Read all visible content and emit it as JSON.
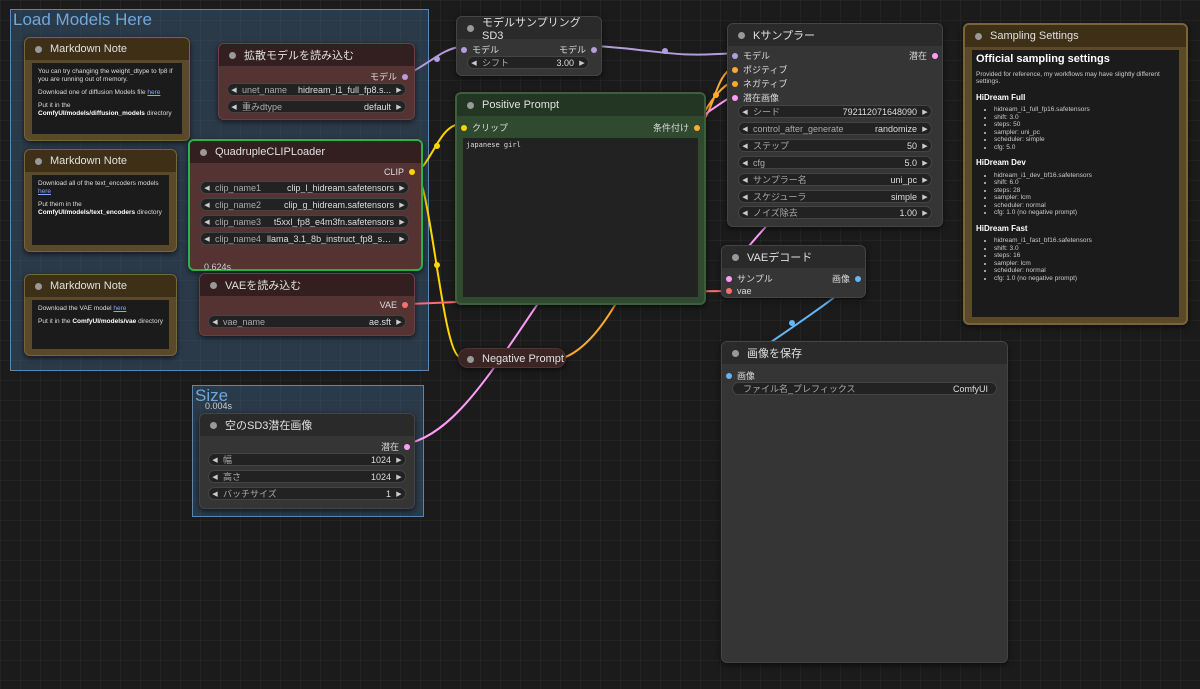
{
  "groups": {
    "load_models": {
      "title": "Load Models Here"
    },
    "size": {
      "title": "Size",
      "time": "0.004s"
    }
  },
  "notes": [
    {
      "title": "Markdown Note",
      "lines": [
        {
          "text": "You can try changing the weight_dtype to fp8 if you are running out of memory."
        },
        {
          "text": "Download one of diffusion Models file ",
          "link": "here"
        },
        {
          "text": "Put it in the ",
          "bold": "ComfyUI/models/diffusion_models",
          "after": " directory"
        }
      ]
    },
    {
      "title": "Markdown Note",
      "lines": [
        {
          "text": "Download all of the text_encoders models ",
          "link": "here"
        },
        {
          "text": "Put them in the ",
          "bold": "ComfyUI/models/text_encoders",
          "after": " directory"
        }
      ]
    },
    {
      "title": "Markdown Note",
      "lines": [
        {
          "text": "Download the VAE model ",
          "link": "here"
        },
        {
          "text": "Put it in the ",
          "bold": "ComfyUI/models/vae",
          "after": " directory"
        }
      ]
    }
  ],
  "unet_loader": {
    "title": "拡散モデルを読み込む",
    "output": "モデル",
    "widgets": [
      {
        "label": "unet_name",
        "value": "hidream_i1_full_fp8.s..."
      },
      {
        "label": "重みdtype",
        "value": "default"
      }
    ]
  },
  "clip_loader": {
    "title": "QuadrupleCLIPLoader",
    "output": "CLIP",
    "time": "0.624s",
    "widgets": [
      {
        "label": "clip_name1",
        "value": "clip_l_hidream.safetensors"
      },
      {
        "label": "clip_name2",
        "value": "clip_g_hidream.safetensors"
      },
      {
        "label": "clip_name3",
        "value": "t5xxl_fp8_e4m3fn.safetensors"
      },
      {
        "label": "clip_name4",
        "value": "llama_3.1_8b_instruct_fp8_sc..."
      }
    ]
  },
  "vae_loader": {
    "title": "VAEを読み込む",
    "output": "VAE",
    "widgets": [
      {
        "label": "vae_name",
        "value": "ae.sft"
      }
    ]
  },
  "model_sampling": {
    "title": "モデルサンプリングSD3",
    "input": "モデル",
    "output": "モデル",
    "widgets": [
      {
        "label": "シフト",
        "value": "3.00"
      }
    ]
  },
  "positive_prompt": {
    "title": "Positive Prompt",
    "input": "クリップ",
    "output": "条件付け",
    "text": "japanese girl"
  },
  "negative_prompt": {
    "title": "Negative Prompt"
  },
  "ksampler": {
    "title": "Kサンプラー",
    "inputs": [
      "モデル",
      "ポジティブ",
      "ネガティブ",
      "潜在画像"
    ],
    "output": "潜在",
    "widgets": [
      {
        "label": "シード",
        "value": "792112071648090"
      },
      {
        "label": "control_after_generate",
        "value": "randomize"
      },
      {
        "label": "ステップ",
        "value": "50"
      },
      {
        "label": "cfg",
        "value": "5.0"
      },
      {
        "label": "サンプラー名",
        "value": "uni_pc"
      },
      {
        "label": "スケジューラ",
        "value": "simple"
      },
      {
        "label": "ノイズ除去",
        "value": "1.00"
      }
    ]
  },
  "vae_decode": {
    "title": "VAEデコード",
    "inputs": [
      "サンプル",
      "vae"
    ],
    "output": "画像"
  },
  "save_image": {
    "title": "画像を保存",
    "input": "画像",
    "widgets": [
      {
        "label": "ファイル名_プレフィックス",
        "value": "ComfyUI"
      }
    ]
  },
  "empty_latent": {
    "title": "空のSD3潜在画像",
    "output": "潜在",
    "widgets": [
      {
        "label": "幅",
        "value": "1024"
      },
      {
        "label": "高さ",
        "value": "1024"
      },
      {
        "label": "バッチサイズ",
        "value": "1"
      }
    ]
  },
  "sampling_settings": {
    "title": "Sampling Settings",
    "heading": "Official sampling settings",
    "intro": "Provided for reference, my workflows may have slightly different settings.",
    "sections": [
      {
        "name": "HiDream Full",
        "items": [
          "hidream_i1_full_fp16.safetensors",
          "shift: 3.0",
          "steps: 50",
          "sampler: uni_pc",
          "scheduler: simple",
          "cfg: 5.0"
        ]
      },
      {
        "name": "HiDream Dev",
        "items": [
          "hidream_i1_dev_bf16.safetensors",
          "shift: 6.0",
          "steps: 28",
          "sampler: lcm",
          "scheduler: normal",
          "cfg: 1.0 (no negative prompt)"
        ]
      },
      {
        "name": "HiDream Fast",
        "items": [
          "hidream_i1_fast_bf16.safetensors",
          "shift: 3.0",
          "steps: 16",
          "sampler: lcm",
          "scheduler: normal",
          "cfg: 1.0 (no negative prompt)"
        ]
      }
    ]
  },
  "colors": {
    "model": "#b39ddb",
    "clip": "#ffd500",
    "vae": "#ff6e6e",
    "latent": "#ff9cf9",
    "conditioning": "#ffa931",
    "image": "#64b5f6"
  }
}
